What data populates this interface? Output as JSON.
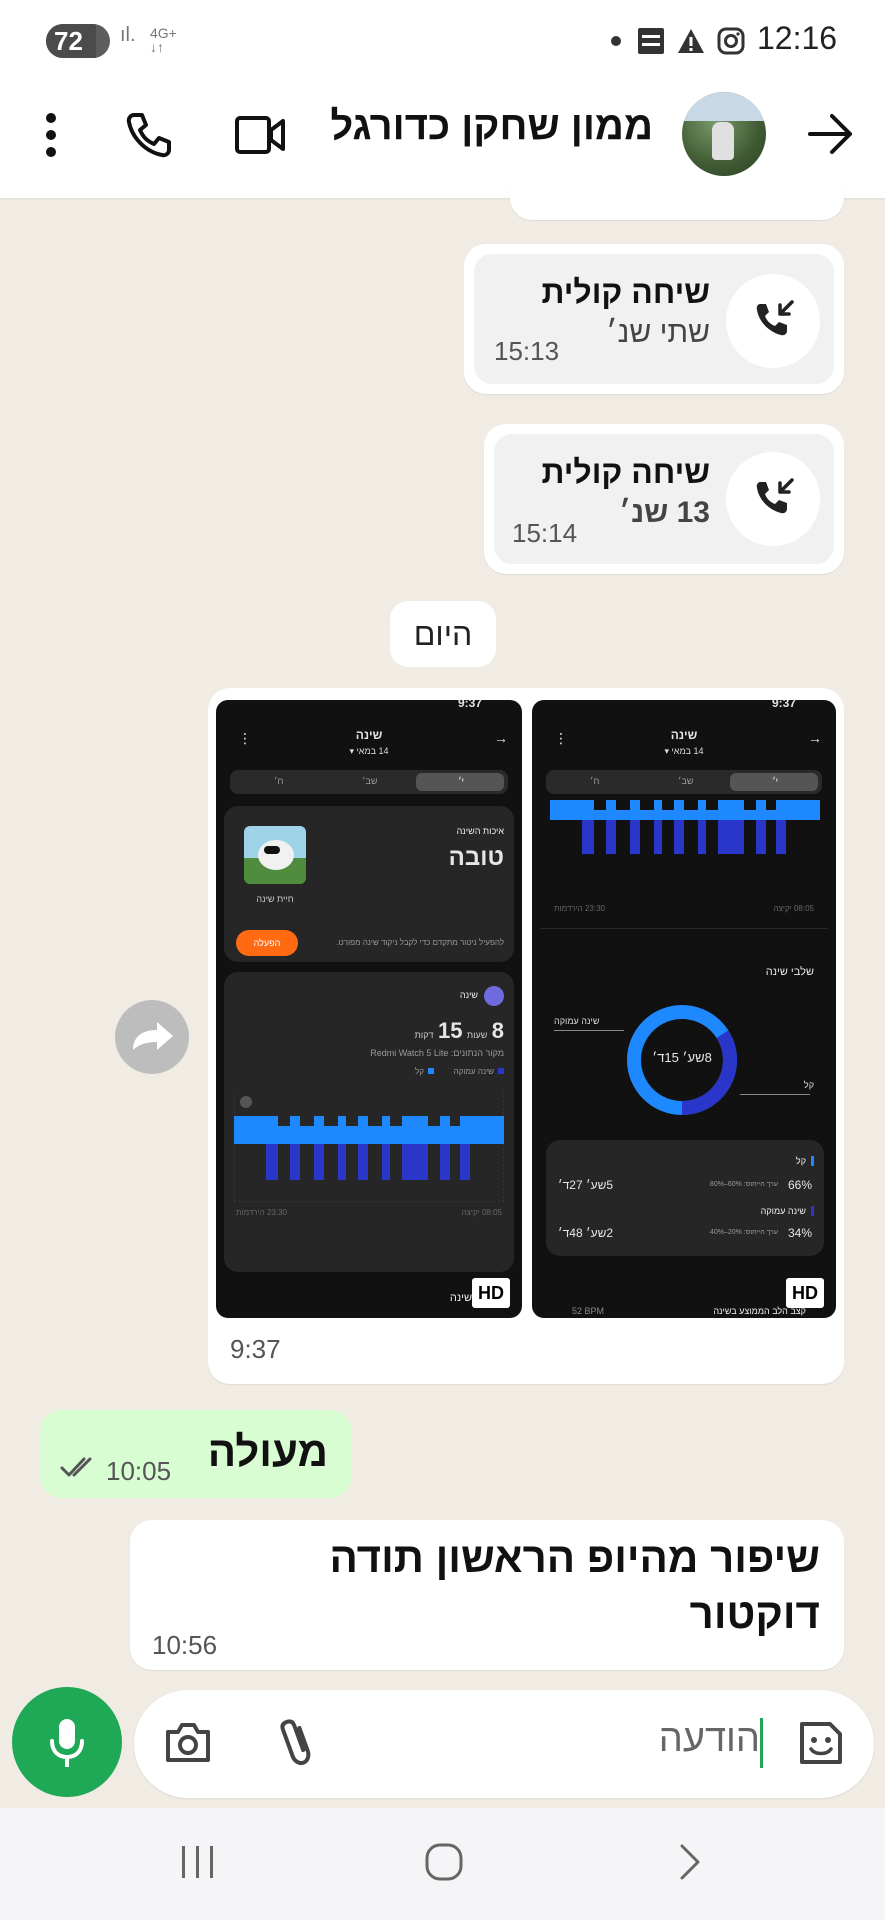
{
  "status_bar": {
    "battery": "72",
    "network": "4G+",
    "time": "12:16"
  },
  "header": {
    "title": "ממון שחקן כדורגל"
  },
  "messages": {
    "call1": {
      "title": "שיחה קולית",
      "subtitle": "שתי שנ׳",
      "time": "15:13"
    },
    "call2": {
      "title": "שיחה קולית",
      "subtitle": "13 שנ׳",
      "time": "15:14"
    },
    "date_chip": "היום",
    "image_msg": {
      "time": "9:37",
      "left_shot": {
        "status_time": "9:37",
        "title": "שינה",
        "date": "14 במאי ▾",
        "tabs": [
          "י׳",
          "שב׳",
          "ח׳"
        ],
        "quality_label": "איכות השינה",
        "quality_value": "טובה",
        "animal_caption": "חיית שינה",
        "activate_button": "הפעלה",
        "hint": "להפעיל ניטור מתקדם כדי לקבל ניקוד שינה מפורט.",
        "sleep_card_title": "שינה",
        "hours": "8",
        "hours_unit": "שעות",
        "minutes": "15",
        "minutes_unit": "דקות",
        "source": "מקור הנתונים: Redmi Watch 5 Lite",
        "legend_light": "קל",
        "legend_deep": "שינה עמוקה",
        "start_label": "23:30 הירדמות",
        "end_label": "08:05 יקיצה",
        "bottom_label": "שינה",
        "hd": "HD"
      },
      "right_shot": {
        "status_time": "9:37",
        "title": "שינה",
        "date": "14 במאי ▾",
        "tabs": [
          "י׳",
          "שב׳",
          "ח׳"
        ],
        "start_label": "23:30 הירדמות",
        "end_label": "08:05 יקיצה",
        "stages_title": "שלבי שינה",
        "deep_callout": "שינה עמוקה",
        "light_callout": "קל",
        "donut_center": "8שע׳ 15ד׳",
        "light_title": "קל",
        "light_pct": "66%",
        "light_range": "ערך הייחוס: 60%–80%",
        "light_dur": "5שע׳ 27ד׳",
        "deep_title": "שינה עמוקה",
        "deep_pct": "34%",
        "deep_range": "ערך הייחוס: 20%–40%",
        "deep_dur": "2שע׳ 48ד׳",
        "hr_label": "קצב הלב הממוצע בשינה",
        "hr_value": "52 BPM",
        "hd": "HD"
      }
    },
    "sent": {
      "text": "מעולה",
      "time": "10:05"
    },
    "received": {
      "text": "שיפור מהיופ הראשון תודה דוקטור",
      "time": "10:56"
    }
  },
  "composer": {
    "placeholder": "הודעה"
  },
  "colors": {
    "accent_green": "#1fa855",
    "sent_bubble": "#d9fdd3",
    "chat_bg": "#f0ece4",
    "sleep_light": "#1e88ff",
    "sleep_deep": "#2a36c9",
    "activate_orange": "#ff6a13"
  }
}
